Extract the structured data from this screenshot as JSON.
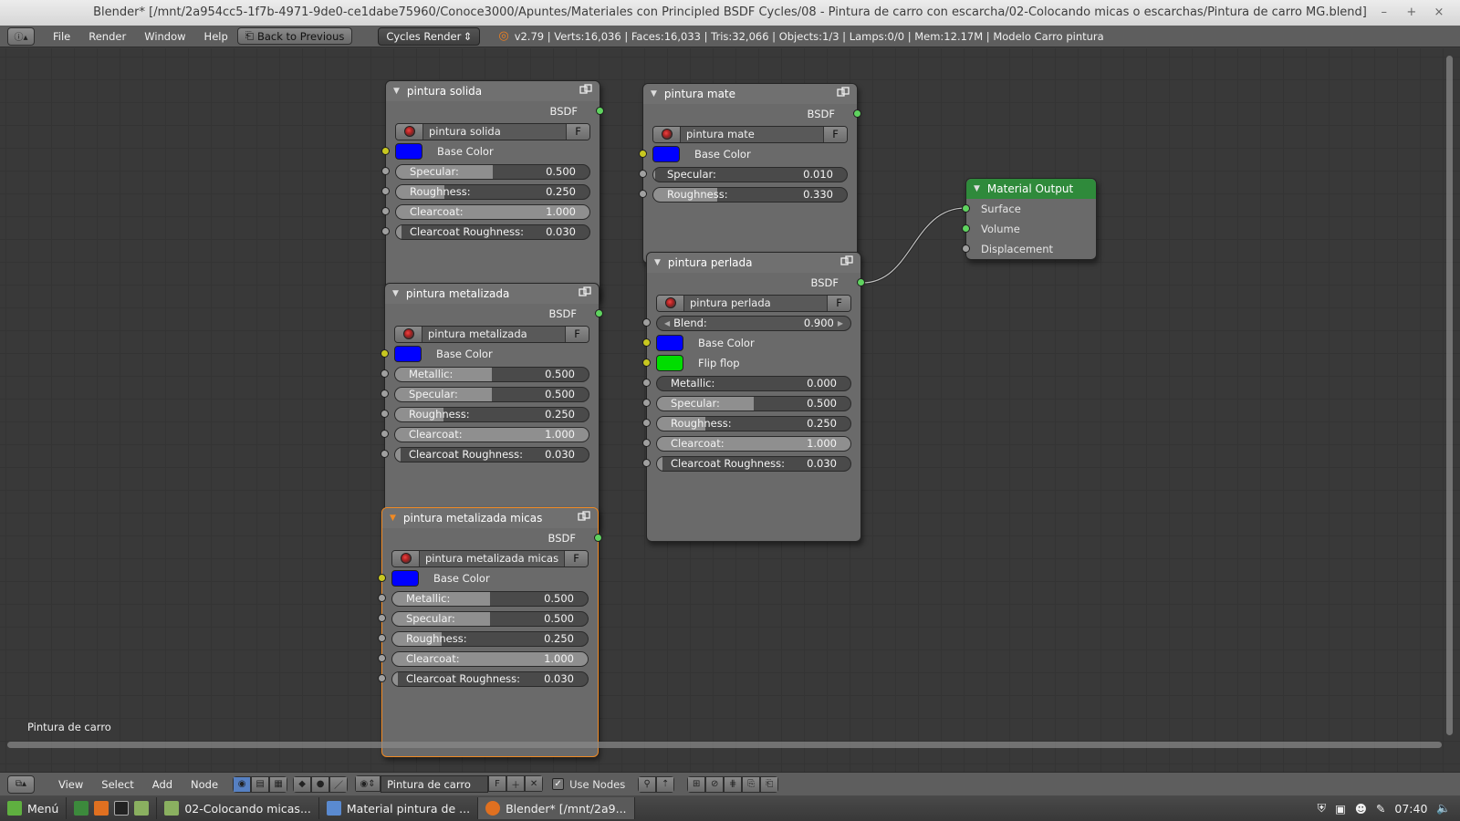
{
  "window": {
    "title": "Blender* [/mnt/2a954cc5-1f7b-4971-9de0-ce1dabe75960/Conoce3000/Apuntes/Materiales con Principled BSDF Cycles/08 - Pintura de carro con escarcha/02-Colocando micas o escarchas/Pintura de carro MG.blend]",
    "min": "–",
    "max": "+",
    "close": "×"
  },
  "infobar": {
    "menus": [
      "File",
      "Render",
      "Window",
      "Help"
    ],
    "back_button": "Back to Previous",
    "render_engine": "Cycles Render",
    "stats": "v2.79 | Verts:16,036 | Faces:16,033 | Tris:32,066 | Objects:1/3 | Lamps:0/0 | Mem:12.17M | Modelo Carro pintura"
  },
  "nodes": {
    "solida": {
      "title": "pintura solida",
      "output": "BSDF",
      "material": "pintura solida",
      "fake": "F",
      "base_color_label": "Base Color",
      "base_color": "#0000ff",
      "fields": [
        {
          "label": "Specular:",
          "value": "0.500",
          "fraction": 0.5
        },
        {
          "label": "Roughness:",
          "value": "0.250",
          "fraction": 0.25
        },
        {
          "label": "Clearcoat:",
          "value": "1.000",
          "fraction": 1.0
        },
        {
          "label": "Clearcoat Roughness:",
          "value": "0.030",
          "fraction": 0.03
        }
      ]
    },
    "mate": {
      "title": "pintura mate",
      "output": "BSDF",
      "material": "pintura mate",
      "fake": "F",
      "base_color_label": "Base Color",
      "base_color": "#0000ff",
      "fields": [
        {
          "label": "Specular:",
          "value": "0.010",
          "fraction": 0.01
        },
        {
          "label": "Roughness:",
          "value": "0.330",
          "fraction": 0.33
        }
      ]
    },
    "metalizada": {
      "title": "pintura metalizada",
      "output": "BSDF",
      "material": "pintura metalizada",
      "fake": "F",
      "base_color_label": "Base Color",
      "base_color": "#0000ff",
      "fields": [
        {
          "label": "Metallic:",
          "value": "0.500",
          "fraction": 0.5
        },
        {
          "label": "Specular:",
          "value": "0.500",
          "fraction": 0.5
        },
        {
          "label": "Roughness:",
          "value": "0.250",
          "fraction": 0.25
        },
        {
          "label": "Clearcoat:",
          "value": "1.000",
          "fraction": 1.0
        },
        {
          "label": "Clearcoat Roughness:",
          "value": "0.030",
          "fraction": 0.03
        }
      ]
    },
    "perlada": {
      "title": "pintura perlada",
      "output": "BSDF",
      "material": "pintura perlada",
      "fake": "F",
      "blend_label": "Blend:",
      "blend_value": "0.900",
      "base_color_label": "Base Color",
      "base_color": "#0000ff",
      "flip_label": "Flip flop",
      "flip_color": "#00dd00",
      "fields": [
        {
          "label": "Metallic:",
          "value": "0.000",
          "fraction": 0.0
        },
        {
          "label": "Specular:",
          "value": "0.500",
          "fraction": 0.5
        },
        {
          "label": "Roughness:",
          "value": "0.250",
          "fraction": 0.25
        },
        {
          "label": "Clearcoat:",
          "value": "1.000",
          "fraction": 1.0
        },
        {
          "label": "Clearcoat Roughness:",
          "value": "0.030",
          "fraction": 0.03
        }
      ]
    },
    "micas": {
      "title": "pintura metalizada micas",
      "output": "BSDF",
      "material": "pintura metalizada micas",
      "fake": "F",
      "base_color_label": "Base Color",
      "base_color": "#0000ff",
      "fields": [
        {
          "label": "Metallic:",
          "value": "0.500",
          "fraction": 0.5
        },
        {
          "label": "Specular:",
          "value": "0.500",
          "fraction": 0.5
        },
        {
          "label": "Roughness:",
          "value": "0.250",
          "fraction": 0.25
        },
        {
          "label": "Clearcoat:",
          "value": "1.000",
          "fraction": 1.0
        },
        {
          "label": "Clearcoat Roughness:",
          "value": "0.030",
          "fraction": 0.03
        }
      ]
    },
    "output": {
      "title": "Material Output",
      "inputs": [
        "Surface",
        "Volume",
        "Displacement"
      ]
    }
  },
  "editor_label": "Pintura de carro",
  "bottombar": {
    "menus": [
      "View",
      "Select",
      "Add",
      "Node"
    ],
    "material": "Pintura de carro",
    "fake": "F",
    "use_nodes": "Use Nodes"
  },
  "taskbar": {
    "menu": "Menú",
    "tasks": [
      "02-Colocando micas...",
      "Material pintura de ...",
      "Blender* [/mnt/2a9..."
    ],
    "time": "07:40"
  }
}
